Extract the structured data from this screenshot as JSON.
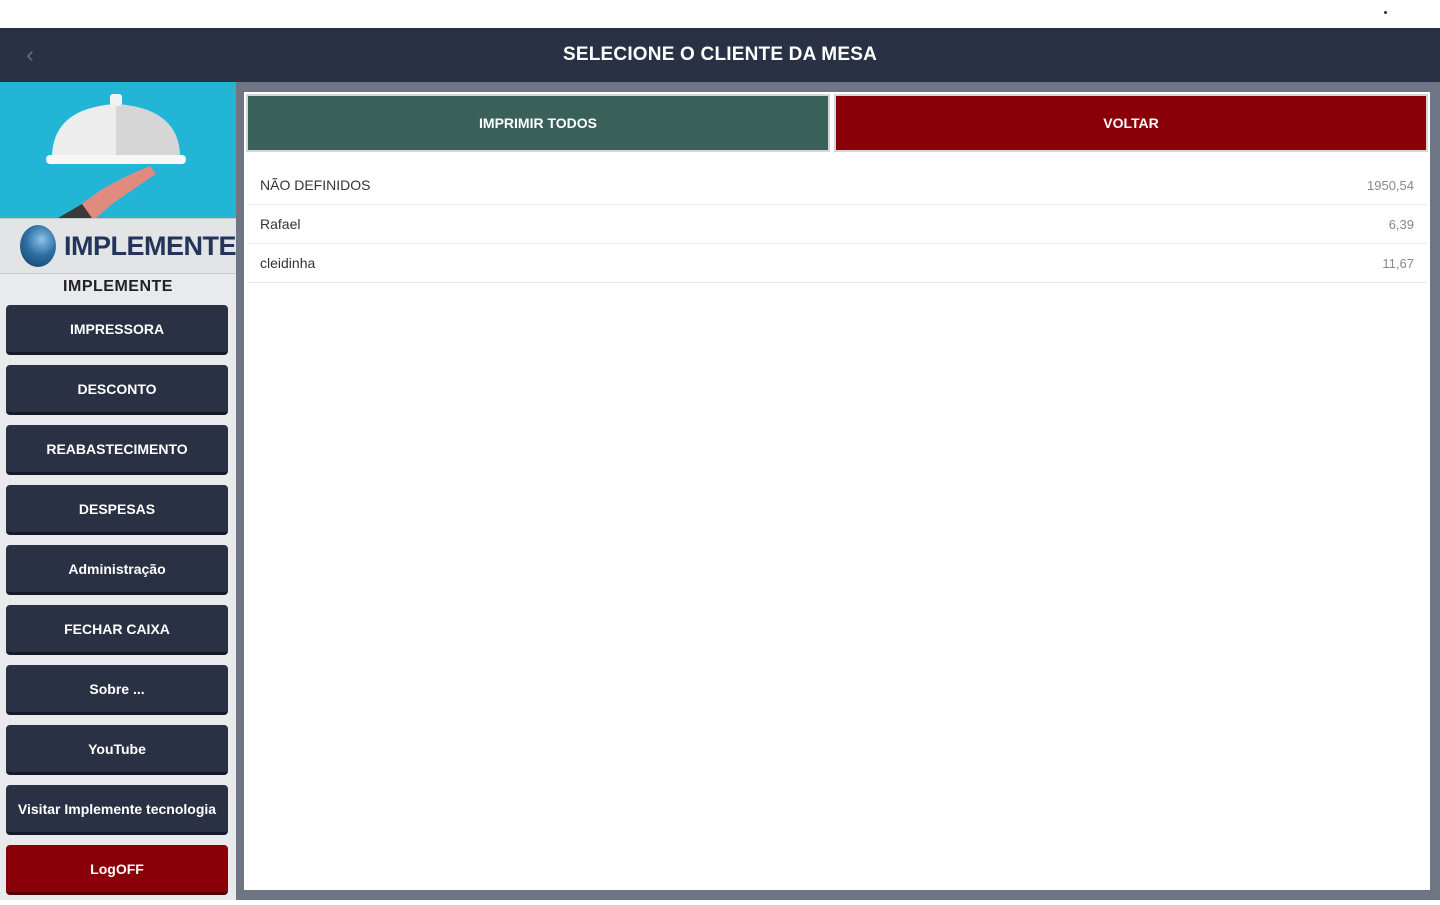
{
  "header": {
    "title": "SELECIONE O CLIENTE DA MESA"
  },
  "sidebar": {
    "logo_text": "IMPLEMENTE",
    "brand_name": "IMPLEMENTE",
    "menu": [
      {
        "label": "IMPRESSORA"
      },
      {
        "label": "DESCONTO"
      },
      {
        "label": "REABASTECIMENTO"
      },
      {
        "label": "DESPESAS"
      },
      {
        "label": "Administração"
      },
      {
        "label": "FECHAR CAIXA"
      },
      {
        "label": "Sobre ..."
      },
      {
        "label": "YouTube"
      },
      {
        "label": "Visitar Implemente tecnologia"
      },
      {
        "label": "LogOFF"
      }
    ]
  },
  "actions": {
    "print_all": "IMPRIMIR TODOS",
    "back": "VOLTAR"
  },
  "clients": [
    {
      "name": "NÃO DEFINIDOS",
      "value": "1950,54"
    },
    {
      "name": "Rafael",
      "value": "6,39"
    },
    {
      "name": "cleidinha",
      "value": "11,67"
    }
  ],
  "colors": {
    "topbar": "#2b3144",
    "accent_cyan": "#22b5d6",
    "print_button": "#3a605a",
    "danger_red": "#8a0008"
  },
  "icons": {
    "back": "chevron-left-icon",
    "hero": "serving-cloche-icon",
    "logo": "globe-logo-icon"
  }
}
